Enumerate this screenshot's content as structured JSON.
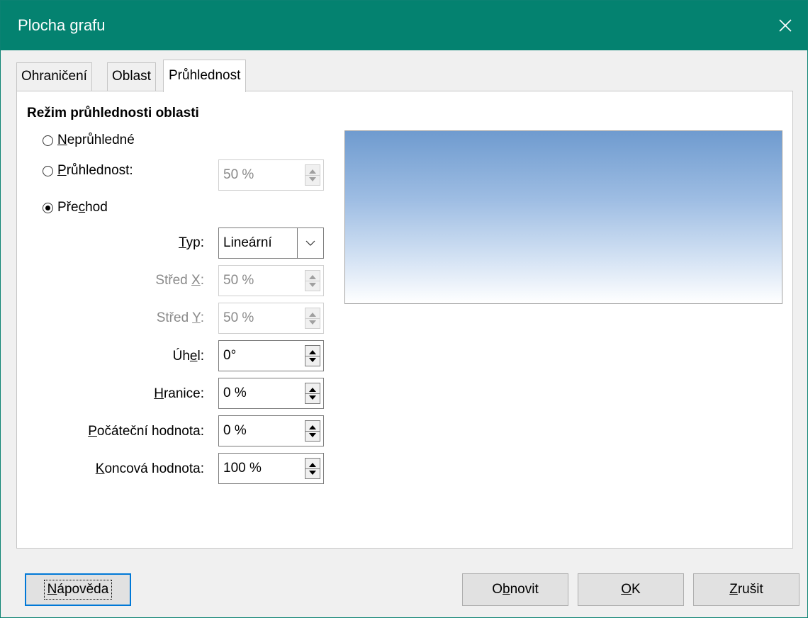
{
  "window": {
    "title": "Plocha grafu"
  },
  "tabs": [
    {
      "label": "Ohraničení"
    },
    {
      "label": "Oblast"
    },
    {
      "label": "Průhlednost"
    }
  ],
  "section": {
    "title": "Režim průhlednosti oblasti"
  },
  "options": {
    "opaque": {
      "pre": "",
      "u": "N",
      "post": "eprůhledné"
    },
    "transparency": {
      "pre": "",
      "u": "P",
      "post": "růhlednost:",
      "value": "50 %"
    },
    "gradient": {
      "pre": "Pře",
      "u": "c",
      "post": "hod"
    }
  },
  "fields": {
    "type": {
      "u": "T",
      "post": "yp:",
      "value": "Lineární"
    },
    "center_x": {
      "pre": "Střed ",
      "u": "X",
      "post": ":",
      "value": "50 %"
    },
    "center_y": {
      "pre": "Střed ",
      "u": "Y",
      "post": ":",
      "value": "50 %"
    },
    "angle": {
      "pre": "Úh",
      "u": "e",
      "post": "l:",
      "value": "0°"
    },
    "border": {
      "pre": "",
      "u": "H",
      "post": "ranice:",
      "value": "0 %"
    },
    "start_value": {
      "pre": "",
      "u": "P",
      "post": "očáteční hodnota:",
      "value": "0 %"
    },
    "end_value": {
      "pre": "",
      "u": "K",
      "post": "oncová hodnota:",
      "value": "100 %"
    }
  },
  "buttons": {
    "help": {
      "pre": "",
      "u": "N",
      "post": "ápověda"
    },
    "reset": {
      "pre": "O",
      "u": "b",
      "post": "novit"
    },
    "ok": {
      "pre": "",
      "u": "O",
      "post": "K"
    },
    "cancel": {
      "pre": "",
      "u": "Z",
      "post": "rušit"
    }
  },
  "colors": {
    "titlebar": "#048270",
    "accent": "#0078d7",
    "gradient_top": "#6f9bcf",
    "gradient_bottom": "#ffffff"
  }
}
